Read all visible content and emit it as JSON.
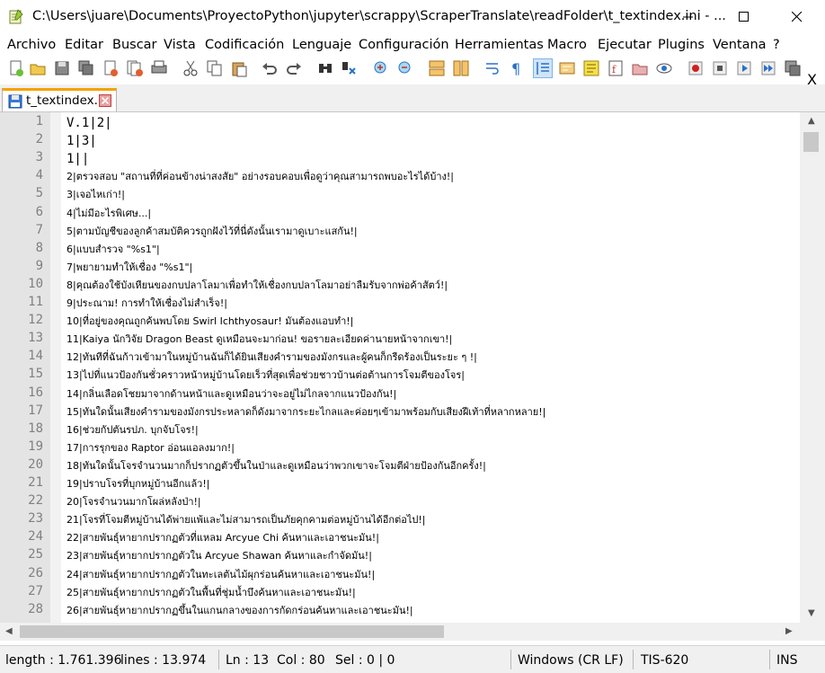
{
  "window": {
    "title": "C:\\Users\\juare\\Documents\\ProyectoPython\\jupyter\\scrappy\\ScraperTranslate\\readFolder\\t_textindex.ini - ...",
    "minimize_icon": "minimize-icon",
    "maximize_icon": "maximize-icon",
    "close_icon": "close-icon"
  },
  "menu": {
    "items": [
      {
        "label": "Archivo"
      },
      {
        "label": "Editar"
      },
      {
        "label": "Buscar"
      },
      {
        "label": "Vista"
      },
      {
        "label": "Codificación"
      },
      {
        "label": "Lenguaje"
      },
      {
        "label": "Configuración"
      },
      {
        "label": "Herramientas"
      },
      {
        "label": "Macro"
      },
      {
        "label": "Ejecutar"
      },
      {
        "label": "Plugins"
      },
      {
        "label": "Ventana"
      },
      {
        "label": "?"
      }
    ],
    "close_doc": "X"
  },
  "toolbar": {
    "buttons": [
      "new-file",
      "open-file",
      "save",
      "save-all",
      "close",
      "close-all",
      "print",
      "cut",
      "copy",
      "paste",
      "undo",
      "redo",
      "find",
      "replace",
      "zoom-in",
      "zoom-out",
      "sync-vertical",
      "sync-horizontal",
      "word-wrap",
      "show-all-chars",
      "indent-guide",
      "user-defined-language",
      "doc-map",
      "function-list",
      "folder-as-workspace",
      "monitoring",
      "record-macro",
      "stop-record",
      "play-macro",
      "run-macro-multiple",
      "save-macro"
    ]
  },
  "tab": {
    "label": "t_textindex.ini"
  },
  "editor": {
    "lines": [
      {
        "n": "1",
        "text": "V.1|2|"
      },
      {
        "n": "2",
        "text": "1|3|"
      },
      {
        "n": "3",
        "text": "1||"
      },
      {
        "n": "4",
        "text": "2|ตรวจสอบ \"สถานที่ที่ค่อนข้างน่าสงสัย\" อย่างรอบคอบเพื่อดูว่าคุณสามารถพบอะไรได้บ้าง!|"
      },
      {
        "n": "5",
        "text": "3|เจอไหเก่า!|"
      },
      {
        "n": "6",
        "text": "4|ไม่มีอะไรพิเศษ...|"
      },
      {
        "n": "7",
        "text": "5|ตามบัญชีของลูกค้าสมบัติควรถูกฝังไว้ที่นี่ดังนั้นเรามาดูเบาะแสกัน!|"
      },
      {
        "n": "8",
        "text": "6|แบบสำรวจ \"%s1\"|"
      },
      {
        "n": "9",
        "text": "7|พยายามทำให้เชื่อง \"%s1\"|"
      },
      {
        "n": "10",
        "text": "8|คุณต้องใช้บังเหียนของกบปลาโลมาเพื่อทำให้เชื่องกบปลาโลมาอย่าลืมรับจากพ่อค้าสัตว์!|"
      },
      {
        "n": "11",
        "text": "9|ประณาม! การทำให้เชื่องไม่สำเร็จ!|"
      },
      {
        "n": "12",
        "text": "10|ที่อยู่ของคุณถูกค้นพบโดย Swirl Ichthyosaur! มันต้องแอบทำ!|"
      },
      {
        "n": "13",
        "text": "11|Kaiya นักวิจัย Dragon Beast ดูเหมือนจะมาก่อน! ขอรายละเอียดค่านายหน้าจากเขา!|"
      },
      {
        "n": "14",
        "text": "12|ทันทีที่ฉันก้าวเข้ามาในหมู่บ้านฉันก็ได้ยินเสียงคำรามของมังกรและผู้คนก็กรีดร้องเป็นระยะ ๆ !|"
      },
      {
        "n": "15",
        "text": "13|ไปที่แนวป้องกันชั่วคราวหน้าหมู่บ้านโดยเร็วที่สุดเพื่อช่วยชาวบ้านต่อต้านการโจมตีของโจร|"
      },
      {
        "n": "16",
        "text": "14|กลิ่นเลือดโชยมาจากด้านหน้าและดูเหมือนว่าจะอยู่ไม่ไกลจากแนวป้องกัน!|"
      },
      {
        "n": "17",
        "text": "15|ทันใดนั้นเสียงคำรามของมังกรประหลาดก็ดังมาจากระยะไกลและค่อยๆเข้ามาพร้อมกับเสียงฝีเท้าที่หลากหลาย!|"
      },
      {
        "n": "18",
        "text": "16|ช่วยกัปตันรปภ. บุกจับโจร!|"
      },
      {
        "n": "19",
        "text": "17|การรุกของ Raptor อ่อนแอลงมาก!|"
      },
      {
        "n": "20",
        "text": "18|ทันใดนั้นโจรจำนวนมากก็ปรากฏตัวขึ้นในป่าและดูเหมือนว่าพวกเขาจะโจมตีฝ่ายป้องกันอีกครั้ง!|"
      },
      {
        "n": "21",
        "text": "19|ปราบโจรที่บุกหมู่บ้านอีกแล้ว!|"
      },
      {
        "n": "22",
        "text": "20|โจรจำนวนมากโผล่หลังป่า!|"
      },
      {
        "n": "23",
        "text": "21|โจรที่โจมตีหมู่บ้านได้พ่ายแพ้และไม่สามารถเป็นภัยคุกคามต่อหมู่บ้านได้อีกต่อไป!|"
      },
      {
        "n": "24",
        "text": "22|สายพันธุ์หายากปรากฏตัวที่แหลม Arcyue Chi ค้นหาและเอาชนะมัน!|"
      },
      {
        "n": "25",
        "text": "23|สายพันธุ์หายากปรากฏตัวใน Arcyue Shawan ค้นหาและกำจัดมัน!|"
      },
      {
        "n": "26",
        "text": "24|สายพันธุ์หายากปรากฏตัวในทะเลตันไม้ผุกร่อนค้นหาและเอาชนะมัน!|"
      },
      {
        "n": "27",
        "text": "25|สายพันธุ์หายากปรากฏตัวในพื้นที่ชุ่มน้ำบึงค้นหาและเอาชนะมัน!|"
      },
      {
        "n": "28",
        "text": "26|สายพันธุ์หายากปรากฏขึ้นในแกนกลางของการกัดกร่อนค้นหาและเอาชนะมัน!|"
      }
    ]
  },
  "status": {
    "length": "length : 1.761.396",
    "lines": "lines : 13.974",
    "ln": "Ln : 13",
    "col": "Col : 80",
    "sel": "Sel : 0 | 0",
    "eol": "Windows (CR LF)",
    "encoding": "TIS-620",
    "mode": "INS"
  }
}
